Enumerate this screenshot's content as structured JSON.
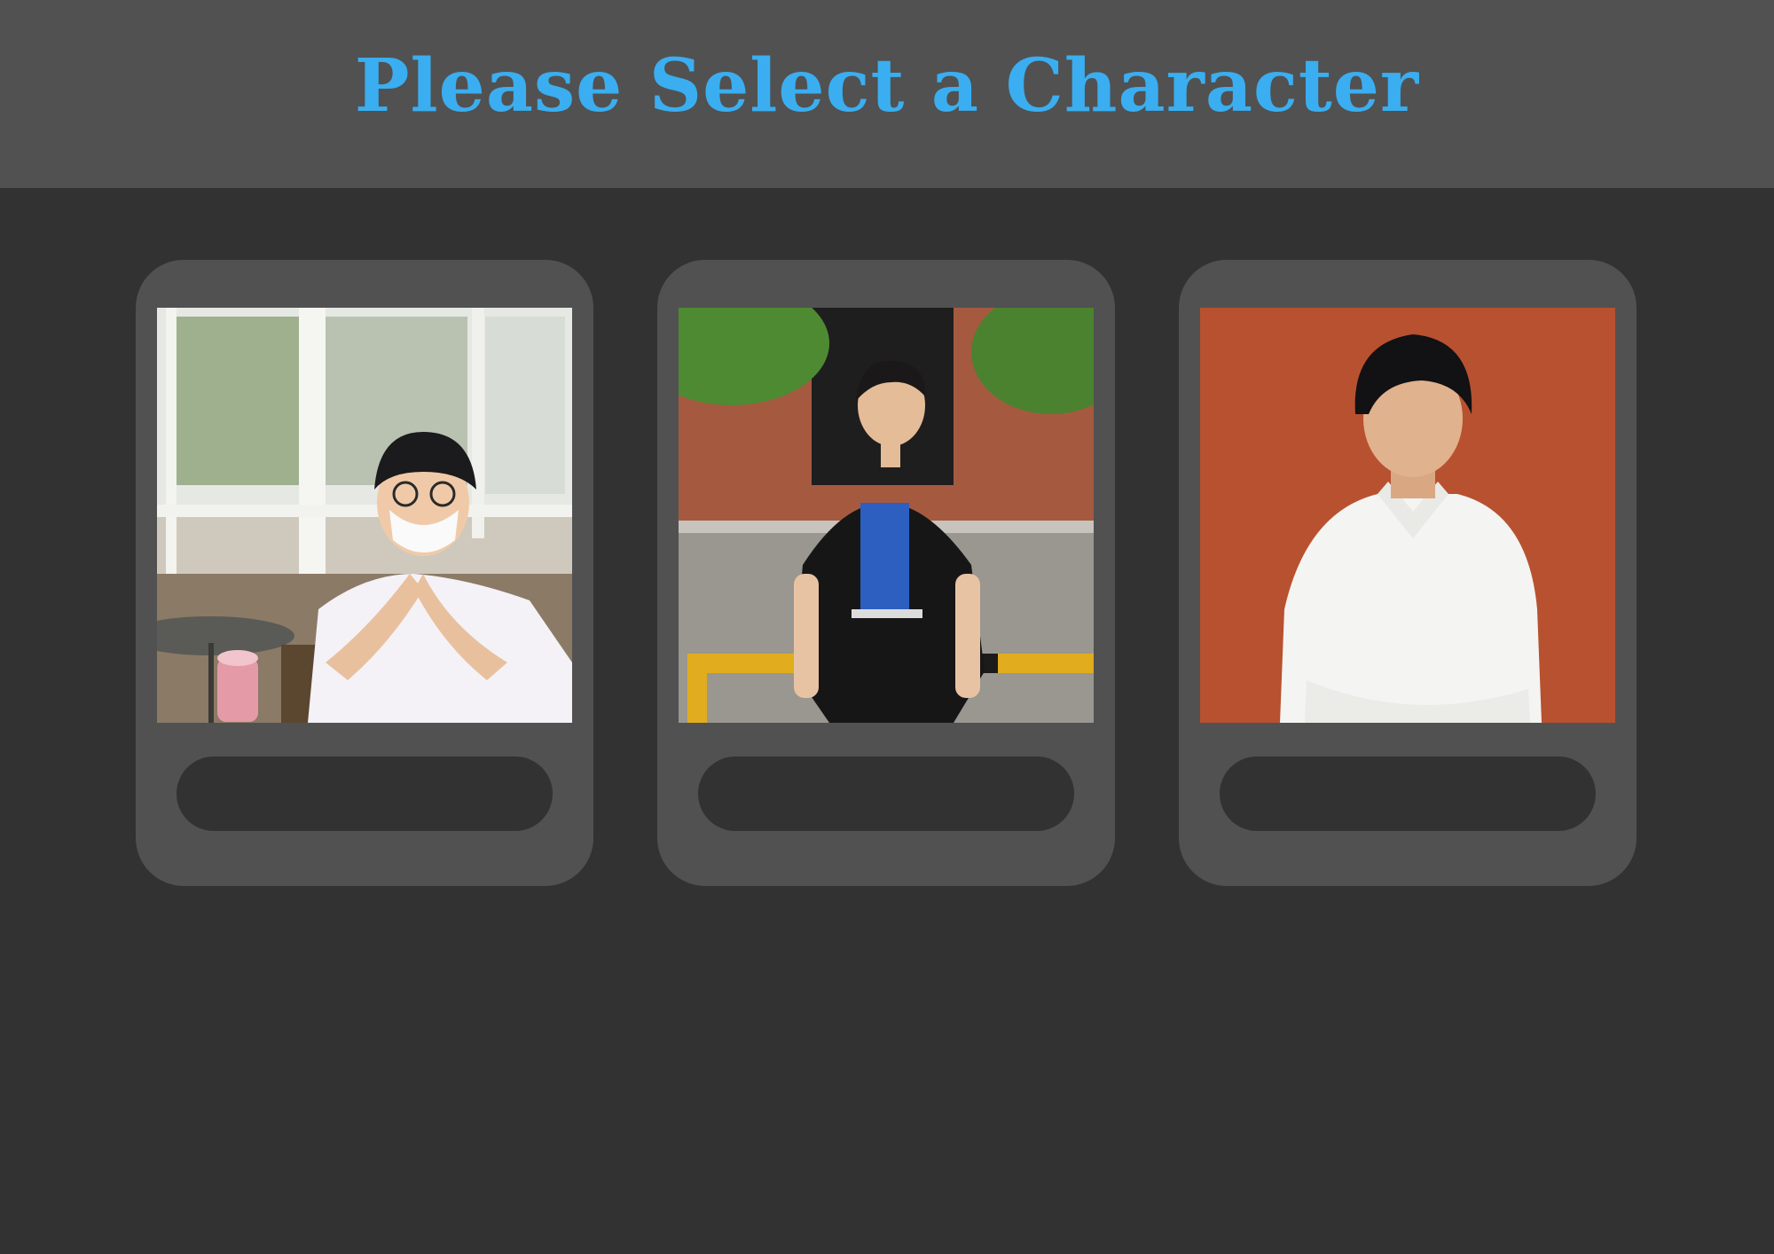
{
  "page": {
    "title": "Please Select a Character"
  },
  "characters": [
    {
      "id": "character-1",
      "button_label": ""
    },
    {
      "id": "character-2",
      "button_label": ""
    },
    {
      "id": "character-3",
      "button_label": ""
    }
  ],
  "colors": {
    "background": "#323232",
    "header": "#515151",
    "card": "#515151",
    "title": "#3aaef0",
    "button": "#323232"
  }
}
